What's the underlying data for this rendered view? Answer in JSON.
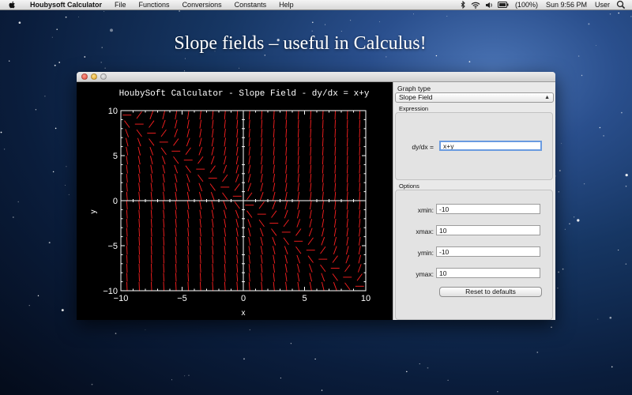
{
  "menubar": {
    "app_name": "Houbysoft Calculator",
    "items": [
      "File",
      "Functions",
      "Conversions",
      "Constants",
      "Help"
    ],
    "battery": "(100%)",
    "clock": "Sun 9:56 PM",
    "user": "User",
    "icons": [
      "apple-icon",
      "bluetooth-icon",
      "wifi-icon",
      "volume-icon",
      "battery-icon"
    ]
  },
  "headline": "Slope fields – useful in Calculus!",
  "panel": {
    "graph_type_label": "Graph type",
    "graph_type_value": "Slope Field",
    "expression_group": "Expression",
    "expression_label": "dy/dx =",
    "expression_value": "x+y",
    "options_group": "Options",
    "xmin_label": "xmin:",
    "xmin_value": "-10",
    "xmax_label": "xmax:",
    "xmax_value": "10",
    "ymin_label": "ymin:",
    "ymin_value": "-10",
    "ymax_label": "ymax:",
    "ymax_value": "10",
    "reset_label": "Reset to defaults"
  },
  "chart_data": {
    "type": "scatter",
    "title": "HoubySoft Calculator - Slope Field - dy/dx = x+y",
    "xlabel": "x",
    "ylabel": "y",
    "xlim": [
      -10,
      10
    ],
    "ylim": [
      -10,
      10
    ],
    "xticks": [
      -10,
      -5,
      0,
      5,
      10
    ],
    "yticks": [
      -10,
      -5,
      0,
      5,
      10
    ],
    "xtick_labels": [
      "−10",
      "−5",
      "0",
      "5",
      "10"
    ],
    "ytick_labels": [
      "−10",
      "−5",
      "0",
      "5",
      "10"
    ],
    "expression": "x+y",
    "grid_count": 20,
    "colors": {
      "segments": "#ff2020",
      "axes": "#ffffff",
      "background": "#000000"
    }
  }
}
